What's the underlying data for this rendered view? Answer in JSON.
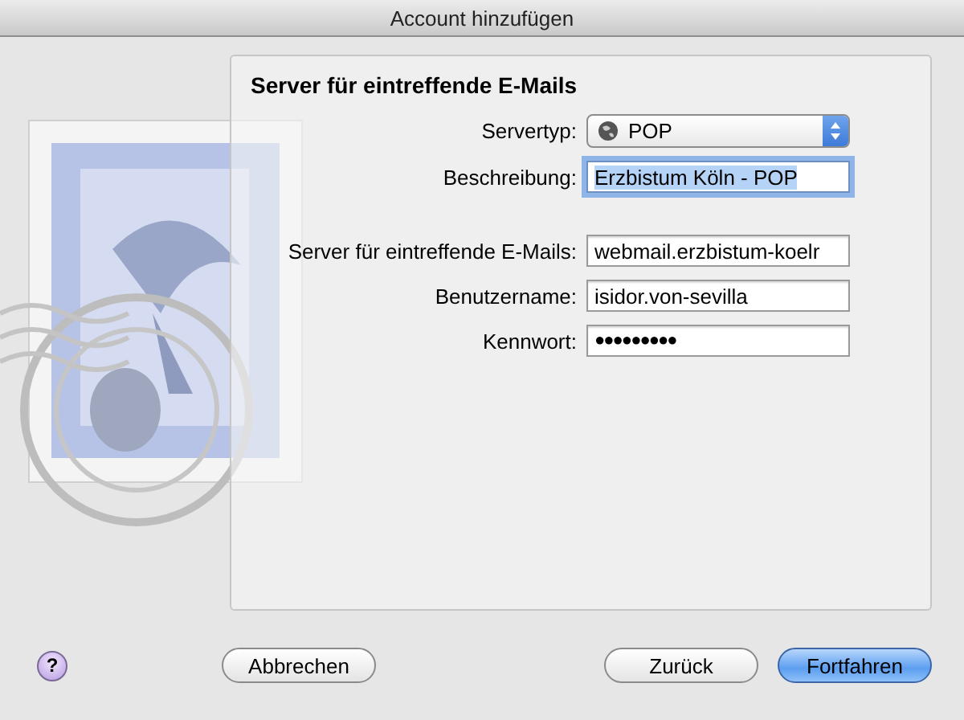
{
  "window": {
    "title": "Account hinzufügen"
  },
  "section": {
    "title": "Server für eintreffende E-Mails"
  },
  "fields": [
    {
      "kind": "popup",
      "label": "Servertyp:",
      "value": "POP"
    },
    {
      "kind": "text",
      "label": "Beschreibung:",
      "value": "Erzbistum Köln - POP",
      "focused": true
    },
    {
      "kind": "text",
      "label": "Server für eintreffende E-Mails:",
      "value": "webmail.erzbistum-koelr",
      "focused": false
    },
    {
      "kind": "text",
      "label": "Benutzername:",
      "value": "isidor.von-sevilla",
      "focused": false
    },
    {
      "kind": "password",
      "label": "Kennwort:",
      "value": "●●●●●●●●●",
      "focused": false
    }
  ],
  "help_button": "?",
  "buttons": [
    {
      "label": "Abbrechen",
      "default": false
    },
    {
      "label": "Zurück",
      "default": false
    },
    {
      "label": "Fortfahren",
      "default": true
    }
  ]
}
